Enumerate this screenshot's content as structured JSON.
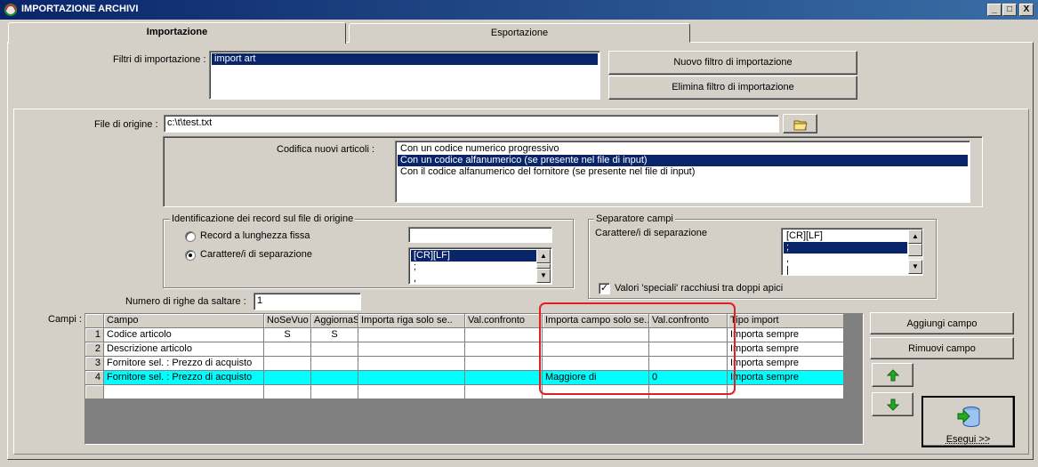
{
  "window": {
    "title": "IMPORTAZIONE ARCHIVI",
    "minimize": "_",
    "maximize": "□",
    "close": "X"
  },
  "tabs": [
    {
      "label": "Importazione"
    },
    {
      "label": "Esportazione"
    }
  ],
  "filters": {
    "label": "Filtri di importazione :",
    "items": [
      "import art"
    ],
    "new_button": "Nuovo filtro di importazione",
    "delete_button": "Elimina filtro di importazione"
  },
  "source": {
    "label": "File di origine :",
    "value": "c:\\t\\test.txt"
  },
  "codifica": {
    "label": "Codifica nuovi articoli :",
    "options": [
      "Con un codice numerico progressivo",
      "Con un codice alfanumerico (se presente nel file di input)",
      "Con il codice alfanumerico del fornitore (se presente nel file di input)"
    ],
    "selected_index": 1
  },
  "identificazione": {
    "title": "Identificazione dei record sul file di origine",
    "option_fixed": "Record a lunghezza fissa",
    "option_sep": "Carattere/i di separazione",
    "selected": "sep",
    "sep_list": [
      "[CR][LF]",
      ";",
      ","
    ]
  },
  "separatore": {
    "title": "Separatore campi",
    "label": "Carattere/i di separazione",
    "list": [
      "[CR][LF]",
      ";",
      ",",
      "|"
    ],
    "selected_index": 1,
    "checkbox_label": "Valori 'speciali' racchiusi tra doppi apici",
    "checkbox_checked": true,
    "check_mark": "✓"
  },
  "skip_rows": {
    "label": "Numero di righe da saltare :",
    "value": "1"
  },
  "campi": {
    "label": "Campi :",
    "columns": [
      "Campo",
      "NoSeVuo",
      "AggiornaS",
      "Importa riga solo se..",
      "Val.confronto",
      "Importa campo solo se..",
      "Val.confronto",
      "Tipo import"
    ],
    "rows": [
      {
        "num": "1",
        "cells": [
          "Codice articolo",
          "S",
          "S",
          "",
          "",
          "",
          "",
          "Importa sempre"
        ]
      },
      {
        "num": "2",
        "cells": [
          "Descrizione articolo",
          "",
          "",
          "",
          "",
          "",
          "",
          "Importa sempre"
        ]
      },
      {
        "num": "3",
        "cells": [
          "Fornitore sel. : Prezzo di acquisto",
          "",
          "",
          "",
          "",
          "",
          "",
          "Importa sempre"
        ]
      },
      {
        "num": "4",
        "cells": [
          "Fornitore sel. : Prezzo di acquisto",
          "",
          "",
          "",
          "",
          "Maggiore di",
          "0",
          "Importa sempre"
        ]
      }
    ],
    "highlight_row": 4,
    "add_button": "Aggiungi campo",
    "remove_button": "Rimuovi campo",
    "run_button": "Esegui >>"
  },
  "colors": {
    "title_bar": "#0a246a",
    "selection": "#0a246a",
    "row_highlight": "#00ffff",
    "annotation": "#e02020",
    "arrow": "#22aa22"
  }
}
